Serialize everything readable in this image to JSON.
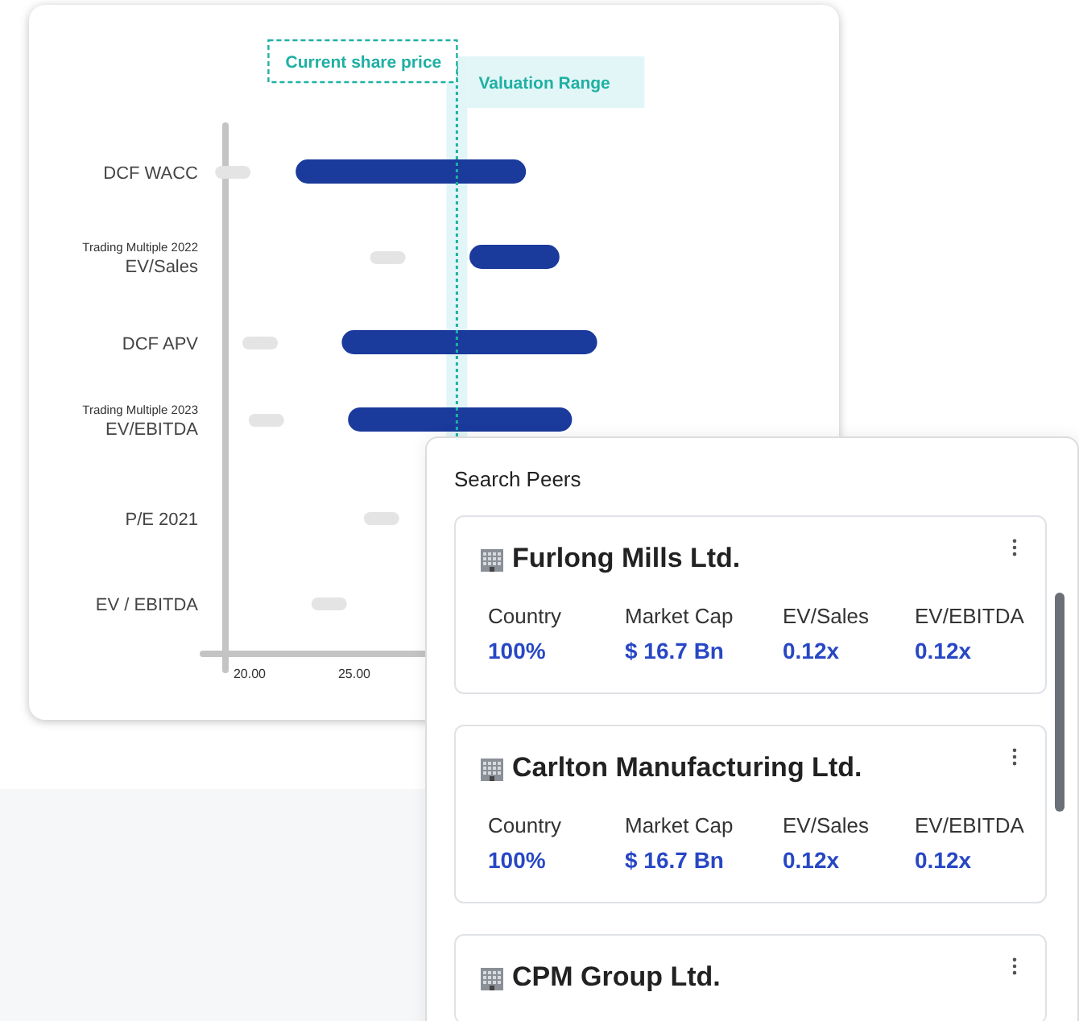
{
  "valuation_chart": {
    "share_price_label": "Current share price",
    "range_label": "Valuation Range",
    "rows": [
      {
        "label": "DCF WACC"
      },
      {
        "caption": "Trading Multiple 2022",
        "label": "EV/Sales"
      },
      {
        "label": "DCF APV"
      },
      {
        "caption": "Trading Multiple 2023",
        "label": "EV/EBITDA"
      },
      {
        "label": "P/E 2021"
      },
      {
        "label": "EV / EBITDA"
      }
    ],
    "axis_labels": [
      "20.00",
      "25.00"
    ]
  },
  "peers_panel": {
    "title": "Search Peers",
    "peers": [
      {
        "name": "Furlong Mills Ltd.",
        "stats": [
          {
            "label": "Country",
            "value": "100%"
          },
          {
            "label": "Market Cap",
            "value": "$ 16.7 Bn"
          },
          {
            "label": "EV/Sales",
            "value": "0.12x"
          },
          {
            "label": "EV/EBITDA",
            "value": "0.12x"
          }
        ]
      },
      {
        "name": "Carlton Manufacturing Ltd.",
        "stats": [
          {
            "label": "Country",
            "value": "100%"
          },
          {
            "label": "Market Cap",
            "value": "$ 16.7 Bn"
          },
          {
            "label": "EV/Sales",
            "value": "0.12x"
          },
          {
            "label": "EV/EBITDA",
            "value": "0.12x"
          }
        ]
      },
      {
        "name": "CPM Group Ltd."
      }
    ]
  }
}
